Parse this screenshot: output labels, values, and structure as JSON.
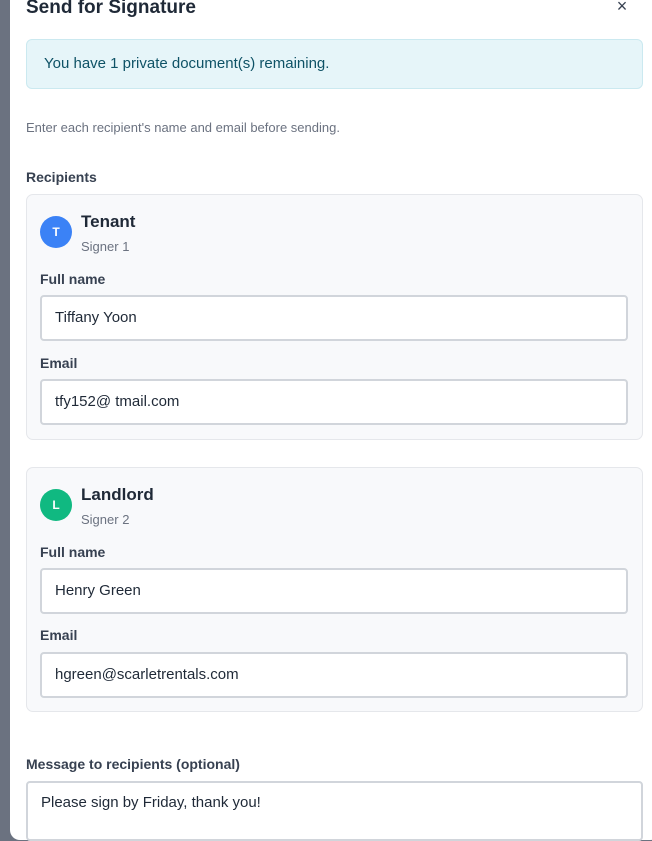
{
  "dialog": {
    "title": "Send for Signature",
    "close_label": "×",
    "notice": "You have 1 private document(s) remaining.",
    "intro": "Enter each recipient's name and email before sending."
  },
  "recipients": {
    "label": "Recipients",
    "items": [
      {
        "initial": "T",
        "avatar_color": "#3b82f6",
        "role": "Tenant",
        "signer": "Signer 1",
        "name_label": "Full name",
        "name_value": "Tiffany Yoon",
        "email_label": "Email",
        "email_value": "tfy152@ tmail.com"
      },
      {
        "initial": "L",
        "avatar_color": "#10b981",
        "role": "Landlord",
        "signer": "Signer 2",
        "name_label": "Full name",
        "name_value": "Henry Green",
        "email_label": "Email",
        "email_value": "hgreen@scarletrentals.com"
      }
    ]
  },
  "message": {
    "label": "Message to recipients (optional)",
    "value": "Please sign by Friday, thank you!"
  }
}
